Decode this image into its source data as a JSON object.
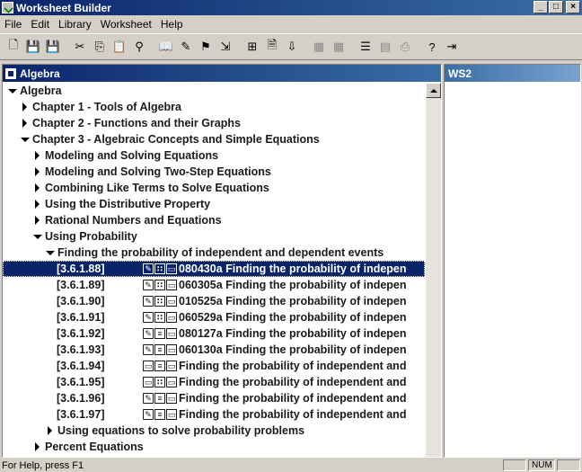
{
  "window": {
    "title": "Worksheet Builder"
  },
  "menu": [
    "File",
    "Edit",
    "Library",
    "Worksheet",
    "Help"
  ],
  "toolbar_icons": [
    "new-icon",
    "save-icon",
    "save-disabled-icon",
    "cut-icon",
    "copy-icon",
    "paste-icon",
    "find-icon",
    "open-book-icon",
    "highlight-icon",
    "flag-icon",
    "import-icon",
    "insert-icon",
    "document-icon",
    "download-icon",
    "grid-icon",
    "grid2-icon",
    "properties-icon",
    "list-icon",
    "print-icon",
    "help-icon",
    "exit-icon"
  ],
  "left_pane": {
    "title": "Algebra"
  },
  "right_pane": {
    "title": "WS2"
  },
  "tree": [
    {
      "indent": 0,
      "arrow": "down",
      "label": "Algebra"
    },
    {
      "indent": 1,
      "arrow": "right",
      "label": "Chapter 1 - Tools of Algebra"
    },
    {
      "indent": 1,
      "arrow": "right",
      "label": "Chapter 2 - Functions and their Graphs"
    },
    {
      "indent": 1,
      "arrow": "down",
      "label": "Chapter 3 - Algebraic Concepts and Simple Equations"
    },
    {
      "indent": 2,
      "arrow": "right",
      "label": "Modeling and Solving Equations"
    },
    {
      "indent": 2,
      "arrow": "right",
      "label": "Modeling and Solving Two-Step Equations"
    },
    {
      "indent": 2,
      "arrow": "right",
      "label": "Combining Like Terms to Solve Equations"
    },
    {
      "indent": 2,
      "arrow": "right",
      "label": "Using the Distributive Property"
    },
    {
      "indent": 2,
      "arrow": "right",
      "label": "Rational Numbers and Equations"
    },
    {
      "indent": 2,
      "arrow": "down",
      "label": "Using Probability"
    },
    {
      "indent": 3,
      "arrow": "down",
      "label": "Finding the probability of independent and dependent events"
    },
    {
      "indent": 4,
      "code": "[3.6.1.88]",
      "icons": [
        "pen",
        "dots",
        "page"
      ],
      "label": "080430a Finding the probability of indepen",
      "selected": true
    },
    {
      "indent": 4,
      "code": "[3.6.1.89]",
      "icons": [
        "pen",
        "dots",
        "page"
      ],
      "label": "060305a Finding the probability of indepen"
    },
    {
      "indent": 4,
      "code": "[3.6.1.90]",
      "icons": [
        "pen",
        "dots",
        "page"
      ],
      "label": "010525a Finding the probability of indepen"
    },
    {
      "indent": 4,
      "code": "[3.6.1.91]",
      "icons": [
        "pen",
        "dots",
        "page"
      ],
      "label": "060529a Finding the probability of indepen"
    },
    {
      "indent": 4,
      "code": "[3.6.1.92]",
      "icons": [
        "pen",
        "lines",
        "page"
      ],
      "label": "080127a Finding the probability of indepen"
    },
    {
      "indent": 4,
      "code": "[3.6.1.93]",
      "icons": [
        "pen",
        "lines",
        "page"
      ],
      "label": "060130a Finding the probability of indepen"
    },
    {
      "indent": 4,
      "code": "[3.6.1.94]",
      "icons": [
        "page",
        "lines",
        "page"
      ],
      "label": "Finding the probability of independent and"
    },
    {
      "indent": 4,
      "code": "[3.6.1.95]",
      "icons": [
        "page",
        "dots",
        "page"
      ],
      "label": "Finding the probability of independent and"
    },
    {
      "indent": 4,
      "code": "[3.6.1.96]",
      "icons": [
        "pen",
        "lines",
        "page"
      ],
      "label": "Finding the probability of independent and"
    },
    {
      "indent": 4,
      "code": "[3.6.1.97]",
      "icons": [
        "pen",
        "lines",
        "page"
      ],
      "label": "Finding the probability of independent and"
    },
    {
      "indent": 3,
      "arrow": "right",
      "label": "Using equations to solve probability problems"
    },
    {
      "indent": 2,
      "arrow": "right",
      "label": "Percent Equations"
    }
  ],
  "status": {
    "text": "For Help, press F1",
    "num": "NUM"
  }
}
